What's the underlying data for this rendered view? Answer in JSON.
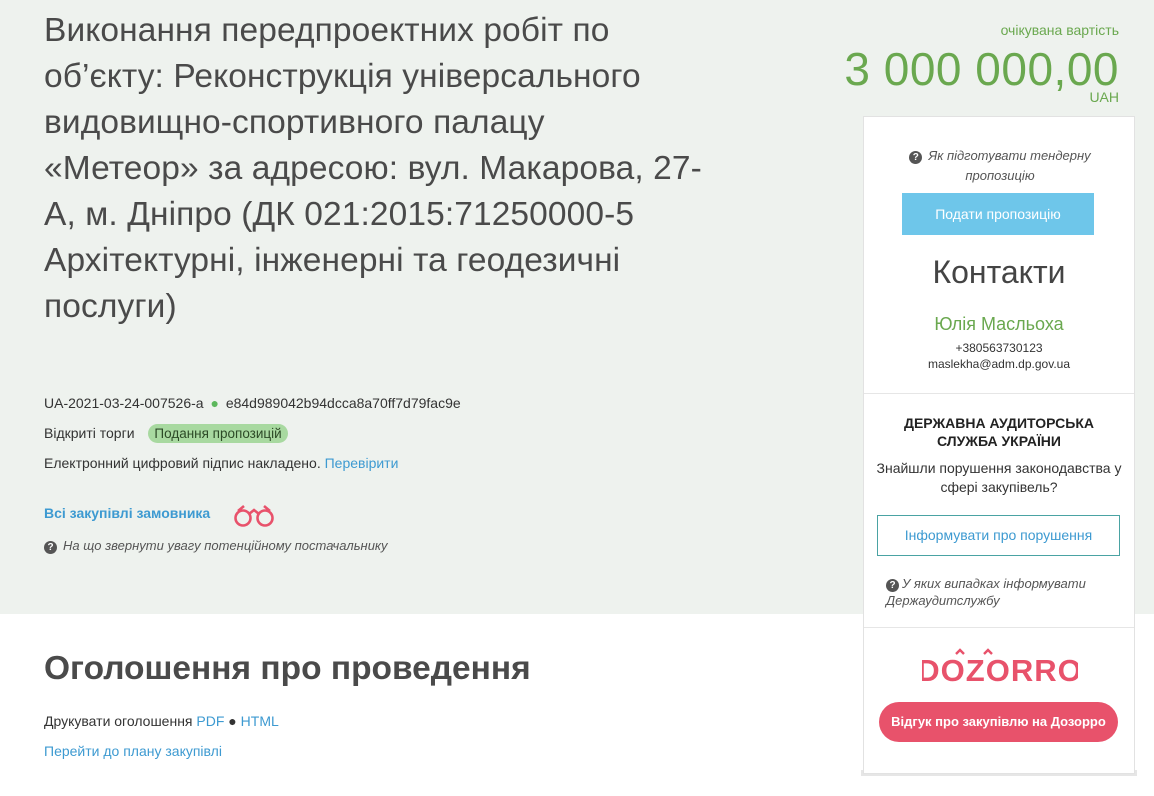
{
  "tender": {
    "title": "Виконання передпроектних робіт по об’єкту: Реконструкція універсального видовищно-спортивного палацу «Метеор» за адресою: вул. Макарова, 27-А, м. Дніпро (ДК 021:2015:71250000-5 Архітектурні, інженерні та геодезичні послуги)",
    "id": "UA-2021-03-24-007526-a",
    "separator": "●",
    "hash": "e84d989042b94dcca8a70ff7d79fac9e",
    "procedure_type": "Відкриті торги",
    "status_badge": "Подання пропозицій",
    "signature_text": "Електронний цифровий підпис накладено.",
    "signature_link": "Перевірити",
    "all_purchases_link": "Всі закупівлі замовника",
    "supplier_hint": "На що звернути увагу потенційному постачальнику",
    "question_icon": "?"
  },
  "price": {
    "label": "очікувана вартість",
    "value": "3 000 000,00",
    "currency": "UAH"
  },
  "panel": {
    "how_to_prepare_hint": "Як підготувати тендерну пропозицію",
    "submit_button": "Подати пропозицію",
    "contacts_title": "Контакти",
    "contact_name": "Юлія Масльоха",
    "contact_phone": "+380563730123",
    "contact_email": "maslekha@adm.dp.gov.ua",
    "audit_title": "ДЕРЖАВНА АУДИТОРСЬКА СЛУЖБА УКРАЇНИ",
    "audit_question": "Знайшли порушення законодавства у сфері закупівель?",
    "inform_button": "Інформувати про порушення",
    "audit_hint": "У яких випадках інформувати Держаудитслужбу",
    "dozorro_logo": "DOZORRO",
    "dozorro_button": "Відгук про закупівлю на Дозорро"
  },
  "announcement": {
    "title": "Оголошення про проведення",
    "print_label": "Друкувати оголошення",
    "pdf_link": "PDF",
    "separator": "●",
    "html_link": "HTML",
    "plan_link": "Перейти до плану закупівлі"
  },
  "colors": {
    "background_band": "#eef2ee",
    "price_green": "#6aa84f",
    "link_blue": "#3d9ad1",
    "submit_button": "#6ec6ea",
    "dozorro_red": "#e8526b",
    "badge_green": "#a8d9a0"
  },
  "icons": [
    "question-circle-icon",
    "binoculars-icon",
    "dozorro-logo"
  ]
}
